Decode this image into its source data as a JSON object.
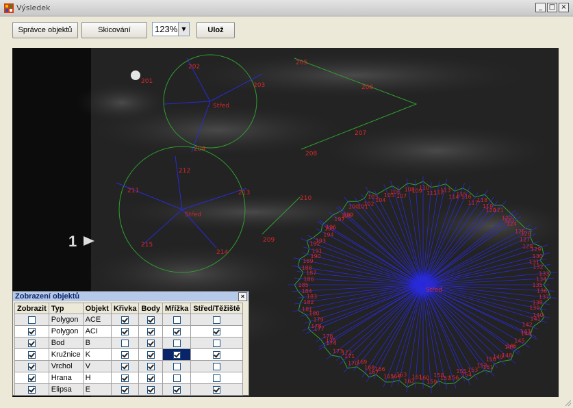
{
  "window": {
    "title": "Výsledek",
    "minimize": "_",
    "maximize": "□",
    "close": "×"
  },
  "toolbar": {
    "spravce_label": "Správce objektů",
    "skicovani_label": "Skicování",
    "zoom_value": "123%",
    "uloz_label": "Ulož"
  },
  "colors": {
    "circle": "#2fa02f",
    "spoke": "#2a2ad8",
    "label": "#d8282a",
    "titlebar": "#c8c8c8",
    "selected_cell": "#0a246a"
  },
  "image": {
    "marker": "1",
    "circle1": {
      "labels": [
        "202",
        "203",
        "204",
        "Střed"
      ]
    },
    "point": {
      "label": "201"
    },
    "triangle": {
      "labels": [
        "205",
        "206",
        "207",
        "208"
      ]
    },
    "circle2": {
      "labels": [
        "211",
        "212",
        "213",
        "214",
        "215",
        "Střed"
      ]
    },
    "small": {
      "labels": [
        "209",
        "210"
      ]
    },
    "polygon": {
      "center_label": "Střed",
      "labels": [
        "110",
        "111",
        "112",
        "113",
        "114",
        "115",
        "116",
        "117",
        "118",
        "119",
        "120",
        "121",
        "122",
        "123",
        "124",
        "125",
        "126",
        "127",
        "128",
        "129",
        "130",
        "131",
        "132",
        "133",
        "134",
        "135",
        "136",
        "137",
        "138",
        "139",
        "140",
        "141",
        "142",
        "143",
        "144",
        "145",
        "146",
        "147",
        "148",
        "149",
        "150",
        "151",
        "152",
        "153",
        "154",
        "155",
        "156",
        "157",
        "158",
        "159",
        "160",
        "161",
        "162",
        "163",
        "164",
        "165",
        "166",
        "167",
        "168",
        "169",
        "170",
        "171",
        "172",
        "173",
        "174",
        "175",
        "176",
        "177",
        "178",
        "179",
        "180",
        "181",
        "182",
        "183",
        "184",
        "185",
        "186",
        "187",
        "188",
        "189",
        "190",
        "191",
        "192",
        "193",
        "194",
        "195",
        "196",
        "197",
        "198",
        "199",
        "100",
        "101",
        "102",
        "103",
        "104",
        "105",
        "106",
        "107",
        "108",
        "109"
      ]
    }
  },
  "panel": {
    "title": "Zobrazení objektů",
    "close": "×",
    "headers": [
      "Zobrazit",
      "Typ",
      "Objekt",
      "Křivka",
      "Body",
      "Mřížka",
      "Střed/Těžiště"
    ],
    "rows": [
      {
        "zobrazit": false,
        "typ": "Polygon",
        "objekt": "ACE",
        "krivka": true,
        "body": true,
        "mrizka": false,
        "stred": false
      },
      {
        "zobrazit": true,
        "typ": "Polygon",
        "objekt": "ACI",
        "krivka": true,
        "body": true,
        "mrizka": true,
        "stred": true
      },
      {
        "zobrazit": true,
        "typ": "Bod",
        "objekt": "B",
        "krivka": false,
        "body": true,
        "mrizka": false,
        "stred": false
      },
      {
        "zobrazit": true,
        "typ": "Kružnice",
        "objekt": "K",
        "krivka": true,
        "body": true,
        "mrizka": true,
        "stred": true
      },
      {
        "zobrazit": true,
        "typ": "Vrchol",
        "objekt": "V",
        "krivka": true,
        "body": true,
        "mrizka": false,
        "stred": false
      },
      {
        "zobrazit": true,
        "typ": "Hrana",
        "objekt": "H",
        "krivka": true,
        "body": true,
        "mrizka": false,
        "stred": false
      },
      {
        "zobrazit": true,
        "typ": "Elipsa",
        "objekt": "E",
        "krivka": true,
        "body": true,
        "mrizka": true,
        "stred": true
      }
    ]
  }
}
